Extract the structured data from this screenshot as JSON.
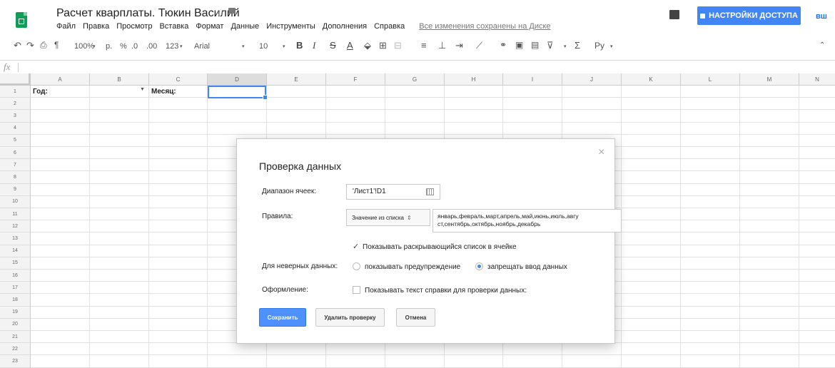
{
  "header": {
    "title": "Расчет кварплаты. Тюкин Василий",
    "menu": [
      "Файл",
      "Правка",
      "Просмотр",
      "Вставка",
      "Формат",
      "Данные",
      "Инструменты",
      "Дополнения",
      "Справка"
    ],
    "save_status": "Все изменения сохранены на Диске",
    "share_label": "НАСТРОЙКИ ДОСТУПА",
    "account_initials": "вш"
  },
  "toolbar": {
    "zoom": "100%",
    "currency": "р.",
    "percent": "%",
    "decimal_less": ".0",
    "decimal_more": ".00",
    "number_format": "123",
    "font": "Arial",
    "font_size": "10",
    "bold": "B",
    "italic": "I",
    "strike": "S",
    "text_color": "A",
    "input_tools": "Ру",
    "sum": "Σ"
  },
  "formula_bar": {
    "fx": "fx"
  },
  "grid": {
    "columns": [
      "A",
      "B",
      "C",
      "D",
      "E",
      "F",
      "G",
      "H",
      "I",
      "J",
      "K",
      "L",
      "M",
      "N"
    ],
    "rows": [
      "1",
      "2",
      "3",
      "4",
      "5",
      "6",
      "7",
      "8",
      "9",
      "10",
      "11",
      "12",
      "13",
      "14",
      "15",
      "16",
      "17",
      "18",
      "19",
      "20",
      "21",
      "22",
      "23"
    ],
    "cells": {
      "A1": "Год:",
      "C1": "Месяц:"
    },
    "selected": "D1"
  },
  "dialog": {
    "title": "Проверка данных",
    "range_label": "Диапазон ячеек:",
    "range_value": "'Лист1'!D1",
    "criteria_label": "Правила:",
    "criteria_type": "Значение из списка",
    "criteria_values_line1": "январь,февраль,март,апрель,май,июнь,июль,авгу",
    "criteria_values_line2": "ст,сентябрь,октябрь,ноябрь,декабрь",
    "show_dropdown_label": "Показывать раскрывающийся список в ячейке",
    "invalid_label": "Для неверных данных:",
    "invalid_warn": "показывать предупреждение",
    "invalid_reject": "запрещать ввод данных",
    "appearance_label": "Оформление:",
    "help_text_label": "Показывать текст справки для проверки данных:",
    "save": "Сохранить",
    "remove": "Удалить проверку",
    "cancel": "Отмена"
  }
}
